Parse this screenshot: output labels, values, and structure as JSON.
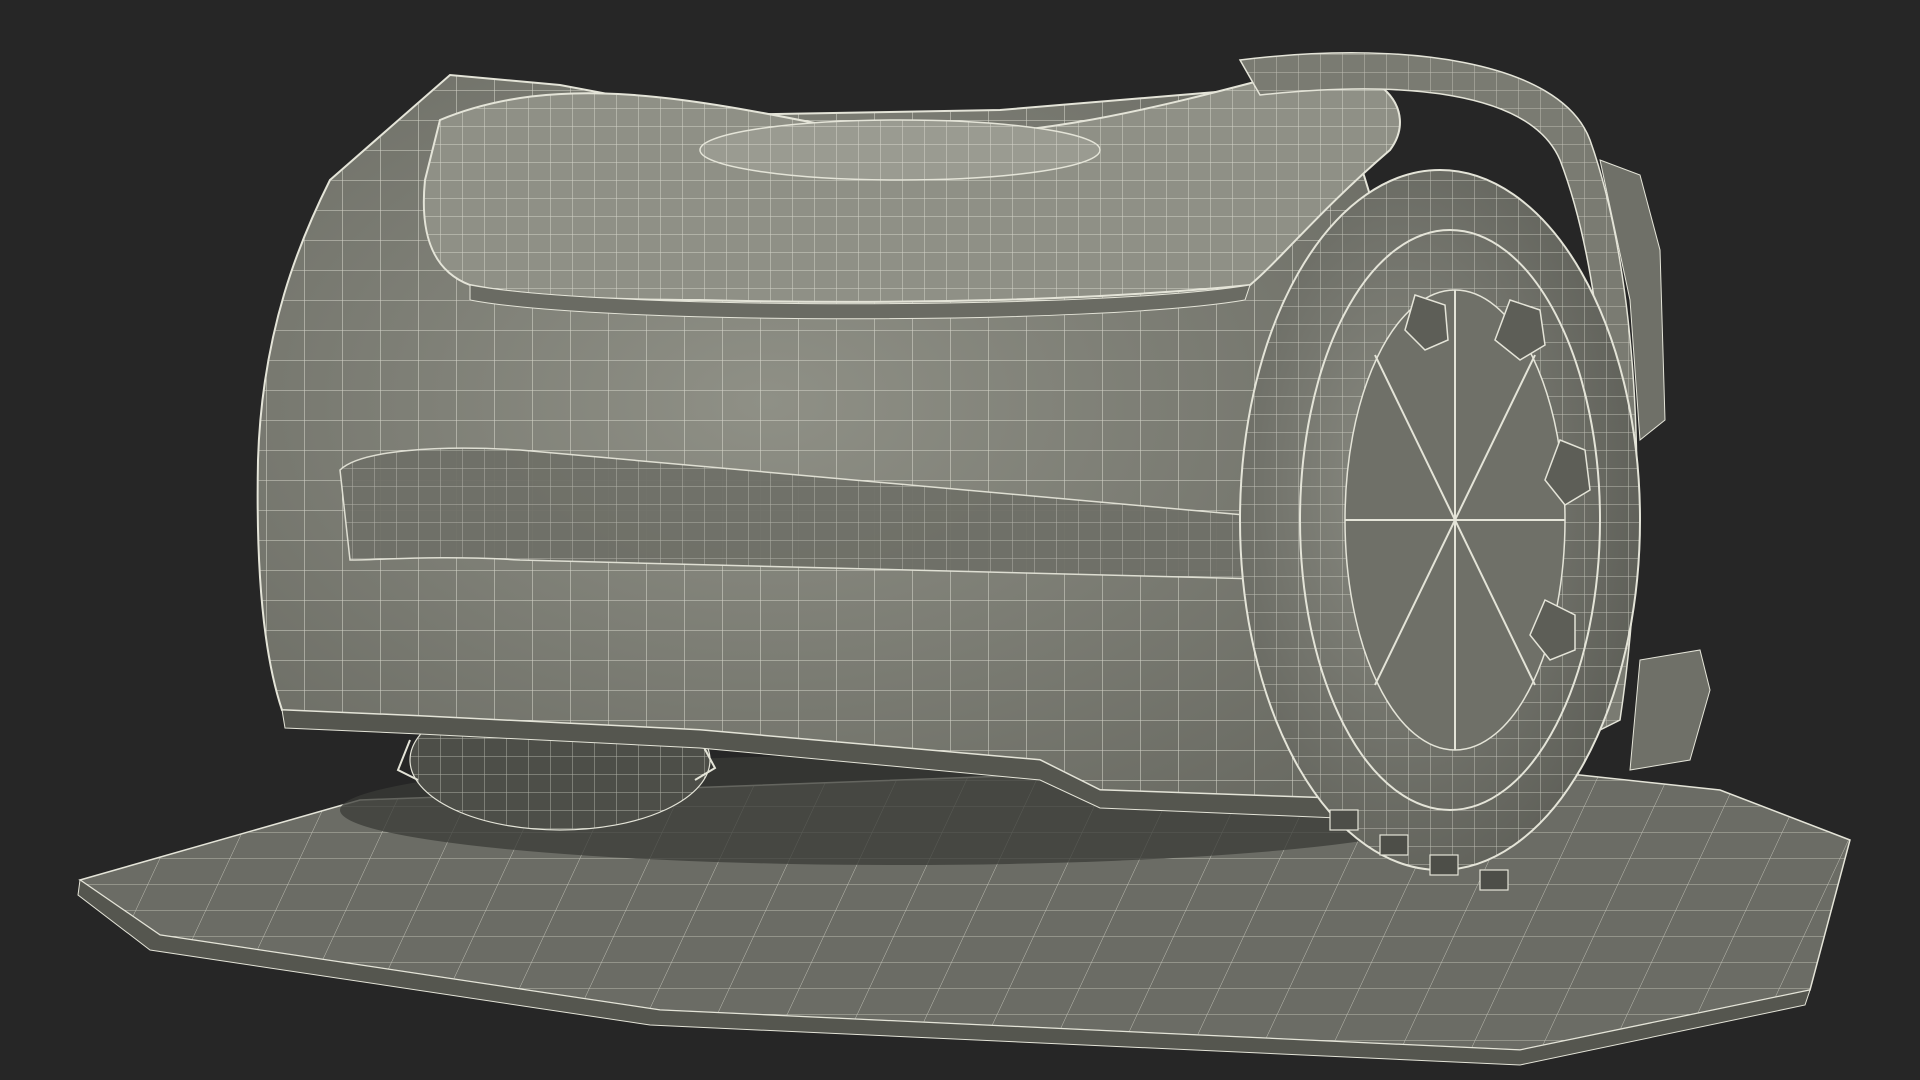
{
  "scene": {
    "subject": "robotic-lawn-mower-wireframe",
    "colors": {
      "background": "#262626",
      "body_fill": "#8a8b80",
      "body_shade": "#6f7068",
      "body_dark": "#55564f",
      "base_fill": "#6b6c65",
      "base_shade": "#5a5b55",
      "wheel_fill": "#76776f",
      "wheel_dark": "#4d4e48",
      "wire": "#e4e4d8",
      "shadow": "#3a3b37"
    }
  }
}
